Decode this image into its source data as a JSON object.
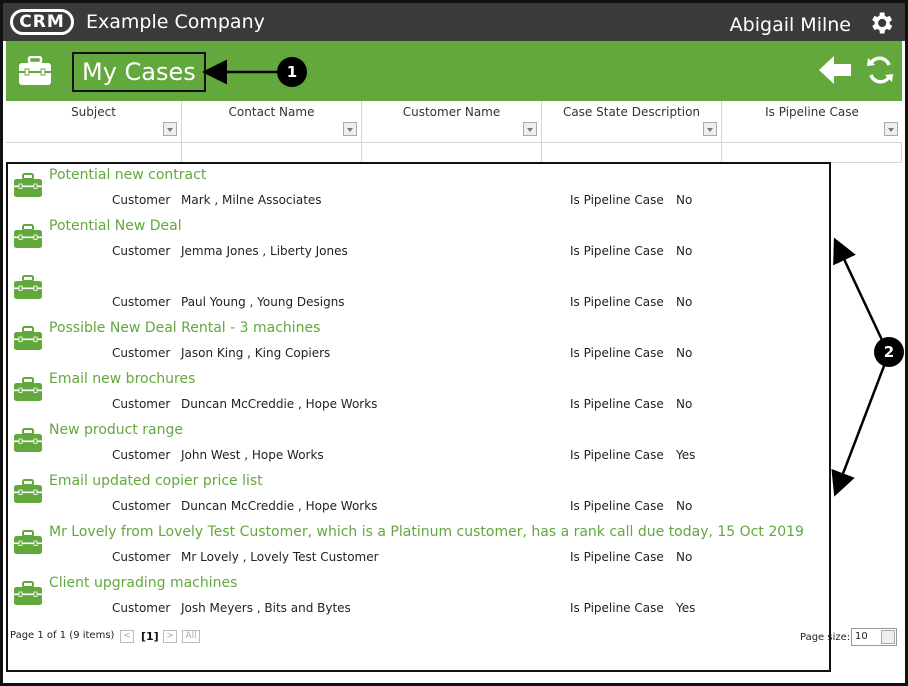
{
  "app": {
    "logo_text": "CRM",
    "company": "Example Company",
    "user": "Abigail Milne"
  },
  "header": {
    "title": "My Cases"
  },
  "columns": [
    "Subject",
    "Contact Name",
    "Customer Name",
    "Case State Description",
    "Is Pipeline Case"
  ],
  "labels": {
    "customer": "Customer",
    "pipeline": "Is Pipeline Case"
  },
  "cases": [
    {
      "subject": "Potential new contract",
      "customer": "Mark , Milne Associates",
      "pipeline": "No"
    },
    {
      "subject": "Potential New Deal",
      "customer": "Jemma Jones , Liberty Jones",
      "pipeline": "No"
    },
    {
      "subject": "",
      "customer": "Paul Young , Young Designs",
      "pipeline": "No"
    },
    {
      "subject": "Possible New Deal Rental - 3 machines",
      "customer": "Jason King , King Copiers",
      "pipeline": "No"
    },
    {
      "subject": "Email new brochures",
      "customer": "Duncan McCreddie , Hope Works",
      "pipeline": "No"
    },
    {
      "subject": "New product range",
      "customer": "John West , Hope Works",
      "pipeline": "Yes"
    },
    {
      "subject": "Email updated copier price list",
      "customer": "Duncan McCreddie , Hope Works",
      "pipeline": "No"
    },
    {
      "subject": "Mr Lovely from Lovely Test Customer, which is a Platinum customer, has a rank call due today, 15 Oct 2019",
      "customer": "Mr Lovely , Lovely Test Customer",
      "pipeline": "No"
    },
    {
      "subject": "Client upgrading machines",
      "customer": "Josh Meyers , Bits and Bytes",
      "pipeline": "Yes"
    }
  ],
  "pager": {
    "summary": "Page 1 of 1 (9 items)",
    "prev": "<",
    "current": "[1]",
    "next": ">",
    "all": "All",
    "page_size_label": "Page size:",
    "page_size": "10"
  },
  "callouts": [
    "1",
    "2"
  ],
  "colors": {
    "green": "#62a83d",
    "topbar": "#3a3a3a"
  }
}
